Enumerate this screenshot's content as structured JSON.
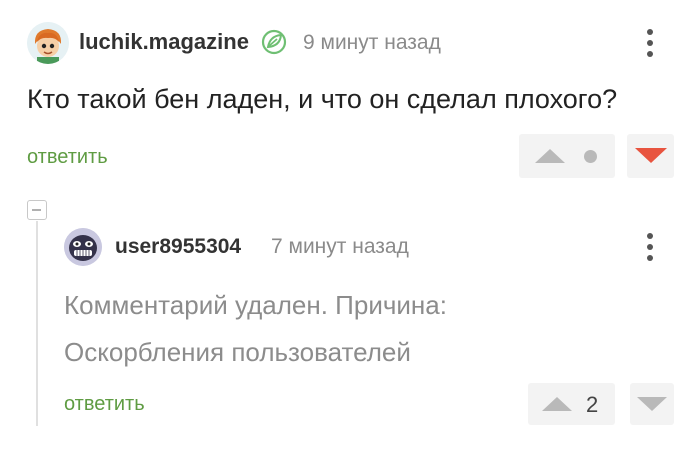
{
  "comment": {
    "author": "luchik.magazine",
    "time": "9 минут назад",
    "text": "Кто такой бен ладен, и что он сделал плохого?",
    "reply_label": "ответить",
    "icons": {
      "avatar": "cartoon-boy-avatar",
      "badge": "leaf-icon",
      "menu": "more-vertical-icon",
      "upvote": "triangle-up-icon",
      "rating": "dot-icon",
      "downvote": "triangle-down-icon"
    },
    "colors": {
      "downvote_active": "#e8543f",
      "reply": "#5f9c43"
    }
  },
  "reply": {
    "author": "user8955304",
    "time": "7 минут назад",
    "deleted_line1": "Комментарий удален. Причина:",
    "deleted_line2": "Оскорбления пользователей",
    "reply_label": "ответить",
    "score": "2",
    "icons": {
      "avatar": "grinning-face-avatar",
      "menu": "more-vertical-icon",
      "collapse": "minus-box-icon",
      "upvote": "triangle-up-icon",
      "downvote": "triangle-down-icon"
    }
  }
}
